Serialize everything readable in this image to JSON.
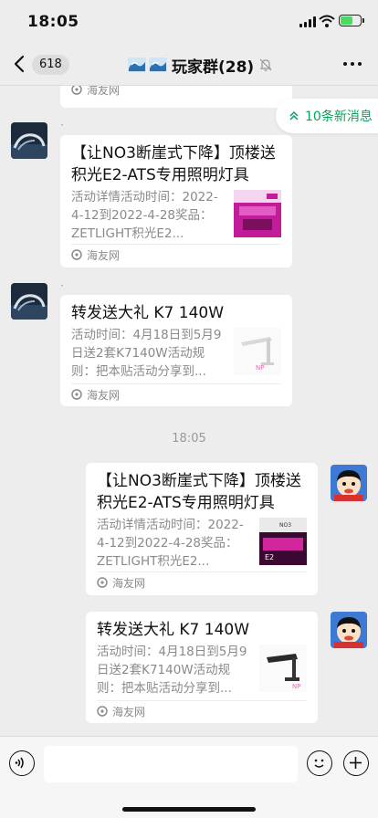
{
  "status_bar": {
    "time": "18:05",
    "icons": [
      "signal-icon",
      "wifi-icon",
      "battery-charging-icon"
    ]
  },
  "nav": {
    "back_icon": "chevron-left-icon",
    "unread_count": "618",
    "title": "玩家群(28)",
    "group_icon": "wave-emoji-icon",
    "mute_icon": "bell-muted-icon",
    "more_icon": "more-dots-icon"
  },
  "new_messages_badge": {
    "icon": "double-chevron-up-icon",
    "text": "10条新消息"
  },
  "messages": [
    {
      "type": "card-tail",
      "source": "海友网"
    },
    {
      "type": "card",
      "side": "left",
      "sender_name": "·",
      "title": "【让NO3断崖式下降】顶楼送积光E2-ATS专用照明灯具",
      "desc": "活动详情活动时间：2022-4-12到2022-4-28奖品：ZETLIGHT积光E2...",
      "thumb": "magenta-aquarium-light-thumb",
      "source": "海友网"
    },
    {
      "type": "card",
      "side": "left",
      "sender_name": "·",
      "title": "转发送大礼 K7 140W",
      "desc": "活动时间：4月18日到5月9日送2套K7140W活动规则：把本贴活动分享到...",
      "thumb": "white-lamp-fixture-thumb",
      "source": "海友网"
    },
    {
      "type": "timestamp",
      "text": "18:05"
    },
    {
      "type": "card",
      "side": "right",
      "title": "【让NO3断崖式下降】顶楼送积光E2-ATS专用照明灯具",
      "desc": "活动详情活动时间：2022-4-12到2022-4-28奖品：ZETLIGHT积光E2...",
      "thumb": "magenta-aquarium-light-thumb",
      "source": "海友网"
    },
    {
      "type": "card",
      "side": "right",
      "title": "转发送大礼 K7 140W",
      "desc": "活动时间：4月18日到5月9日送2套K7140W活动规则：把本贴活动分享到...",
      "thumb": "black-lamp-fixture-thumb",
      "source": "海友网"
    }
  ],
  "input_bar": {
    "voice_icon": "voice-icon",
    "emoji_icon": "emoji-icon",
    "plus_icon": "plus-icon"
  },
  "colors": {
    "accent_green": "#07a35a",
    "bg": "#ededed"
  }
}
